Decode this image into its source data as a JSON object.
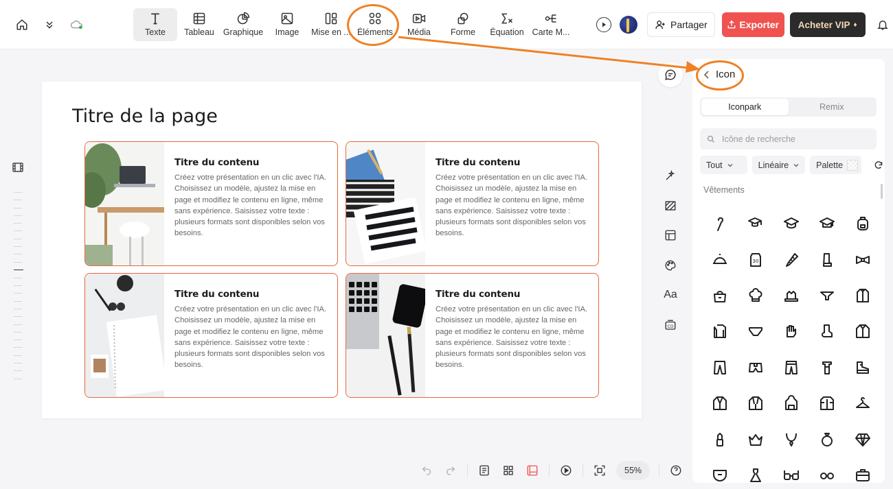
{
  "toolbar": {
    "tools": [
      {
        "label": "Texte",
        "icon": "text-icon"
      },
      {
        "label": "Tableau",
        "icon": "table-icon"
      },
      {
        "label": "Graphique",
        "icon": "chart-icon"
      },
      {
        "label": "Image",
        "icon": "image-icon"
      },
      {
        "label": "Mise en ...",
        "icon": "layout-icon"
      },
      {
        "label": "Éléments",
        "icon": "elements-icon"
      },
      {
        "label": "Média",
        "icon": "media-icon"
      },
      {
        "label": "Forme",
        "icon": "shape-icon"
      },
      {
        "label": "Équation",
        "icon": "equation-icon"
      },
      {
        "label": "Carte M...",
        "icon": "mindmap-icon"
      }
    ],
    "share_label": "Partager",
    "export_label": "Exporter",
    "vip_label": "Acheter VIP"
  },
  "slide": {
    "title": "Titre de la page",
    "cards": [
      {
        "title": "Titre du contenu",
        "body": "Créez votre présentation en un clic avec l'IA. Choisissez un modèle, ajustez la mise en page et modifiez le contenu en ligne, même sans expérience. Saisissez votre texte : plusieurs formats sont disponibles selon vos besoins."
      },
      {
        "title": "Titre du contenu",
        "body": "Créez votre présentation en un clic avec l'IA. Choisissez un modèle, ajustez la mise en page et modifiez le contenu en ligne, même sans expérience. Saisissez votre texte : plusieurs formats sont disponibles selon vos besoins."
      },
      {
        "title": "Titre du contenu",
        "body": "Créez votre présentation en un clic avec l'IA. Choisissez un modèle, ajustez la mise en page et modifiez le contenu en ligne, même sans expérience. Saisissez votre texte : plusieurs formats sont disponibles selon vos besoins."
      },
      {
        "title": "Titre du contenu",
        "body": "Créez votre présentation en un clic avec l'IA. Choisissez un modèle, ajustez la mise en page et modifiez le contenu en ligne, même sans expérience. Saisissez votre texte : plusieurs formats sont disponibles selon vos besoins."
      }
    ]
  },
  "panel": {
    "title": "Icon",
    "tabs": [
      "Iconpark",
      "Remix"
    ],
    "search_placeholder": "Icône de recherche",
    "filter_all": "Tout",
    "filter_style": "Linéaire",
    "filter_palette": "Palette",
    "category": "Vêtements"
  },
  "right_strip": {
    "font_label": "Aa"
  },
  "bottom": {
    "zoom": "55%"
  },
  "colors": {
    "accent": "#f0524f",
    "card_border": "#e8673c",
    "annotation": "#f08024"
  }
}
